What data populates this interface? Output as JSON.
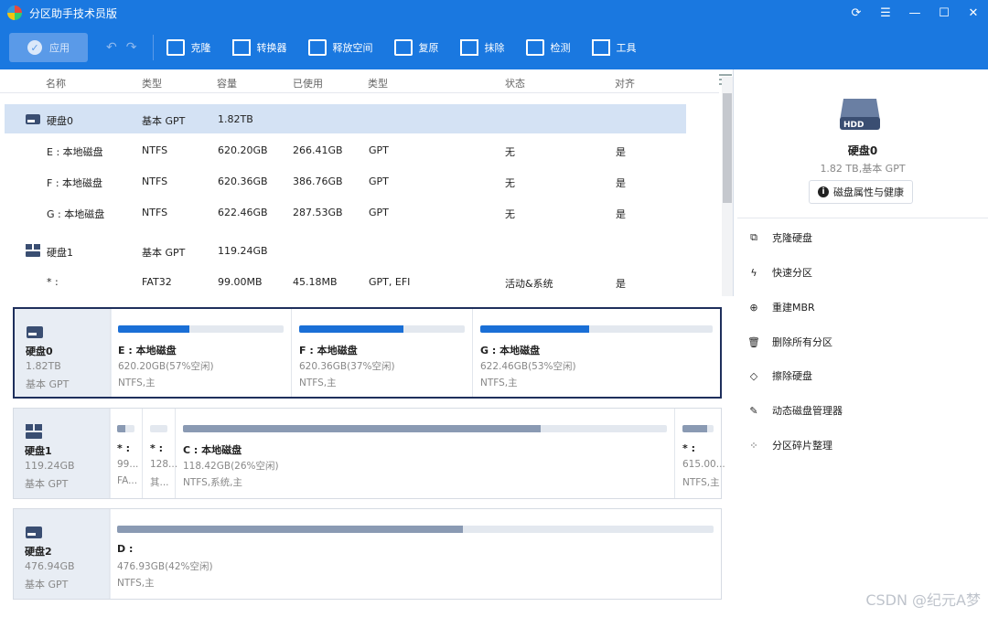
{
  "app": {
    "title": "分区助手技术员版"
  },
  "toolbar": {
    "apply": "应用",
    "items": [
      "克隆",
      "转换器",
      "释放空间",
      "复原",
      "抹除",
      "检测",
      "工具"
    ]
  },
  "table": {
    "headers": [
      "名称",
      "类型",
      "容量",
      "已使用",
      "类型",
      "状态",
      "对齐"
    ],
    "rows": [
      {
        "name": "硬盘0",
        "type": "基本 GPT",
        "capacity": "1.82TB",
        "used": "",
        "ptype": "",
        "status": "",
        "align": ""
      },
      {
        "name": "E : 本地磁盘",
        "type": "NTFS",
        "capacity": "620.20GB",
        "used": "266.41GB",
        "ptype": "GPT",
        "status": "无",
        "align": "是"
      },
      {
        "name": "F : 本地磁盘",
        "type": "NTFS",
        "capacity": "620.36GB",
        "used": "386.76GB",
        "ptype": "GPT",
        "status": "无",
        "align": "是"
      },
      {
        "name": "G : 本地磁盘",
        "type": "NTFS",
        "capacity": "622.46GB",
        "used": "287.53GB",
        "ptype": "GPT",
        "status": "无",
        "align": "是"
      },
      {
        "name": "硬盘1",
        "type": "基本 GPT",
        "capacity": "119.24GB",
        "used": "",
        "ptype": "",
        "status": "",
        "align": ""
      },
      {
        "name": "* :",
        "type": "FAT32",
        "capacity": "99.00MB",
        "used": "45.18MB",
        "ptype": "GPT, EFI",
        "status": "活动&系统",
        "align": "是"
      }
    ]
  },
  "disks": [
    {
      "name": "硬盘0",
      "size": "1.82TB",
      "type": "基本 GPT",
      "parts": [
        {
          "label": "E : 本地磁盘",
          "info": "620.20GB(57%空闲)",
          "fs": "NTFS,主",
          "fill": 0.43
        },
        {
          "label": "F : 本地磁盘",
          "info": "620.36GB(37%空闲)",
          "fs": "NTFS,主",
          "fill": 0.63
        },
        {
          "label": "G : 本地磁盘",
          "info": "622.46GB(53%空闲)",
          "fs": "NTFS,主",
          "fill": 0.47
        }
      ]
    },
    {
      "name": "硬盘1",
      "size": "119.24GB",
      "type": "基本 GPT",
      "parts": [
        {
          "label": "* :",
          "info": "99...",
          "fs": "FA...",
          "fill": 0.45
        },
        {
          "label": "* :",
          "info": "128...",
          "fs": "其...",
          "fill": 0.0
        },
        {
          "label": "C : 本地磁盘",
          "info": "118.42GB(26%空闲)",
          "fs": "NTFS,系统,主",
          "fill": 0.74
        },
        {
          "label": "* :",
          "info": "615.00...",
          "fs": "NTFS,主",
          "fill": 0.8
        }
      ]
    },
    {
      "name": "硬盘2",
      "size": "476.94GB",
      "type": "基本 GPT",
      "parts": [
        {
          "label": "D :",
          "info": "476.93GB(42%空闲)",
          "fs": "NTFS,主",
          "fill": 0.58
        }
      ]
    }
  ],
  "right_panel": {
    "disk_name": "硬盘0",
    "disk_sub": "1.82 TB,基本 GPT",
    "props_button": "磁盘属性与健康",
    "actions": [
      "克隆硬盘",
      "快速分区",
      "重建MBR",
      "删除所有分区",
      "擦除硬盘",
      "动态磁盘管理器",
      "分区碎片整理"
    ]
  },
  "watermark": "CSDN @纪元A梦",
  "colors": {
    "accent": "#1a78e0",
    "bar_blue": "#1a6fd6",
    "bar_gray": "#8a9ab3"
  }
}
